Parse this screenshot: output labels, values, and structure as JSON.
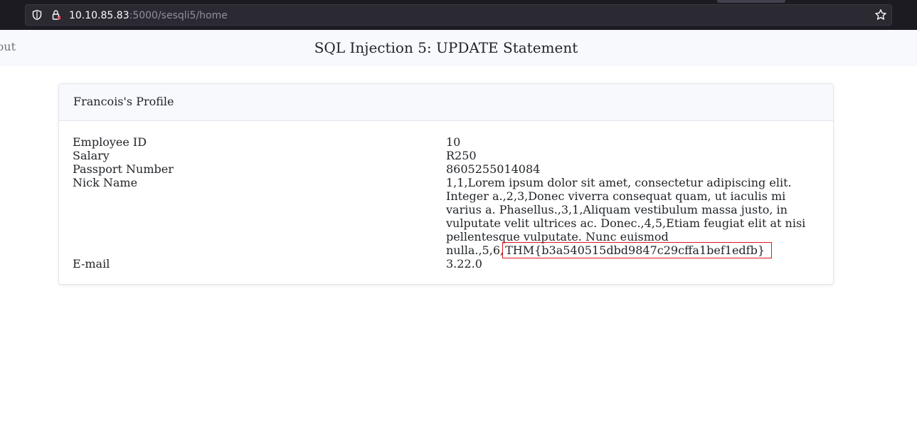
{
  "browser": {
    "url_host": "10.10.85.83",
    "url_path": ":5000/sesqli5/home"
  },
  "header": {
    "logout_label": "out",
    "title": "SQL Injection 5: UPDATE Statement"
  },
  "profile": {
    "title": "Francois's Profile",
    "fields": [
      {
        "label": "Employee ID",
        "value": "10"
      },
      {
        "label": "Salary",
        "value": "R250"
      },
      {
        "label": "Passport Number",
        "value": "8605255014084"
      },
      {
        "label": "Nick Name",
        "value_prefix": "1,1,Lorem ipsum dolor sit amet, consectetur adipiscing elit. Integer a.,2,3,Donec viverra consequat quam, ut iaculis mi varius a. Phasellus.,3,1,Aliquam vestibulum massa justo, in vulputate velit ultrices ac. Donec.,4,5,Etiam feugiat elit at nisi pellentesque vulputate. Nunc euismod nulla.,5,6,",
        "value_flag": "THM{b3a540515dbd9847c29cffa1bef1edfb}"
      },
      {
        "label": "E-mail",
        "value": "3.22.0"
      }
    ]
  },
  "colors": {
    "browser_chrome": "#1c1b22",
    "header_bg": "#f8f9fc",
    "highlight_border": "#e0161e"
  },
  "icons": [
    "shield-icon",
    "lock-icon",
    "star-icon"
  ]
}
